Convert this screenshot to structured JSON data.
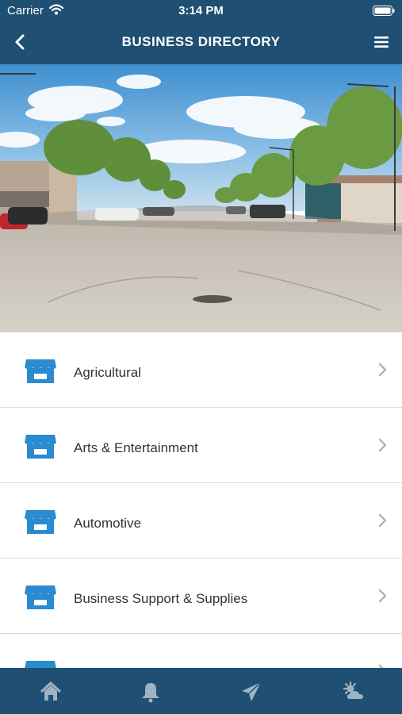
{
  "status_bar": {
    "carrier": "Carrier",
    "time": "3:14 PM"
  },
  "nav": {
    "title": "BUSINESS DIRECTORY",
    "back_icon": "chevron-left-icon",
    "menu_icon": "hamburger-menu-icon"
  },
  "colors": {
    "nav_bg": "#1f4f72",
    "icon_blue": "#2a8bd0",
    "text": "#333333"
  },
  "categories": [
    {
      "label": "Agricultural"
    },
    {
      "label": "Arts & Entertainment"
    },
    {
      "label": "Automotive"
    },
    {
      "label": "Business Support & Supplies"
    },
    {
      "label": ""
    }
  ],
  "tab_bar": {
    "items": [
      {
        "icon": "home-icon"
      },
      {
        "icon": "bell-icon"
      },
      {
        "icon": "paper-plane-icon"
      },
      {
        "icon": "weather-icon"
      }
    ]
  }
}
